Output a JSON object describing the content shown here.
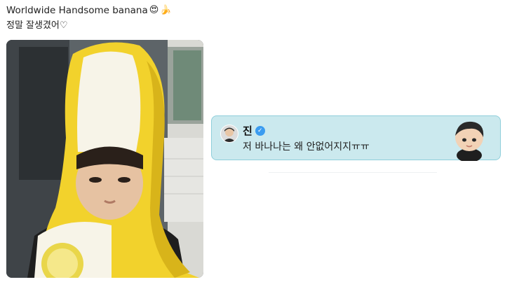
{
  "post": {
    "line1": "Worldwide Handsome banana",
    "emoji1": "😍",
    "emoji2": "🍌",
    "line2": "정말 잘생겼어♡"
  },
  "comment": {
    "author": "진",
    "verified_icon": "check",
    "text": "저 바나나는 왜 안없어지지ㅠㅠ"
  },
  "colors": {
    "card_bg": "#cbe9ee",
    "card_border": "#8fcfdb",
    "verified": "#3b9cf0",
    "banana": "#f2d22c"
  }
}
